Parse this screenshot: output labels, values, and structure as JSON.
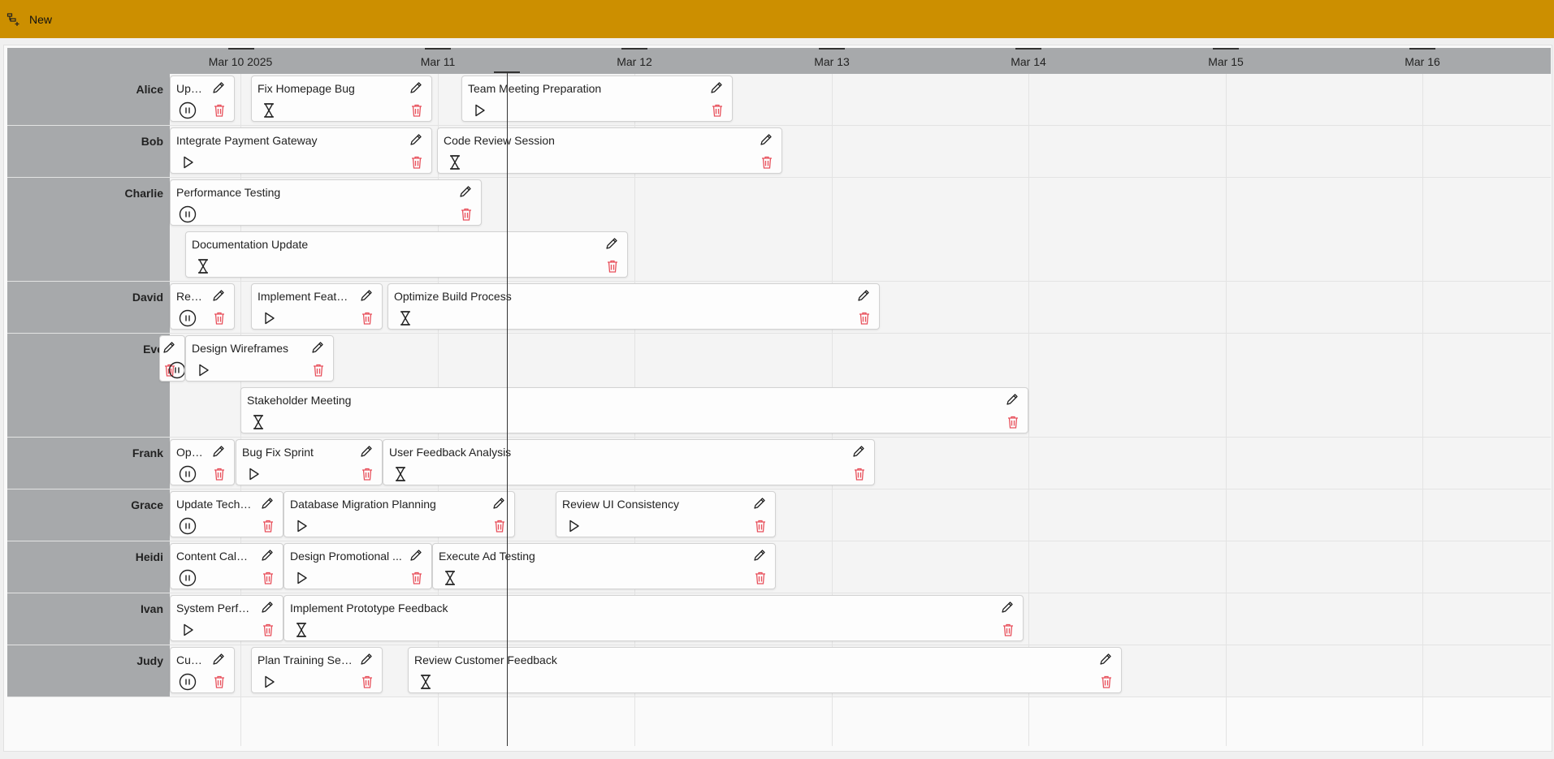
{
  "toolbar": {
    "new_label": "New"
  },
  "timeline": {
    "day_labels": [
      "Mar 10 2025",
      "Mar 11",
      "Mar 12",
      "Mar 13",
      "Mar 14",
      "Mar 15",
      "Mar 16"
    ]
  },
  "lanes": [
    "Alice",
    "Bob",
    "Charlie",
    "David",
    "Eve",
    "Frank",
    "Grace",
    "Heidi",
    "Ivan",
    "Judy"
  ],
  "tasks": [
    {
      "title": "Upd...",
      "status": "paused"
    },
    {
      "title": "Fix Homepage Bug",
      "status": "pending"
    },
    {
      "title": "Team Meeting Preparation",
      "status": "ready"
    },
    {
      "title": "Integrate Payment Gateway",
      "status": "ready"
    },
    {
      "title": "Code Review Session",
      "status": "pending"
    },
    {
      "title": "Performance Testing",
      "status": "paused"
    },
    {
      "title": "Documentation Update",
      "status": "pending"
    },
    {
      "title": "Revi...",
      "status": "paused"
    },
    {
      "title": "Implement Featur...",
      "status": "ready"
    },
    {
      "title": "Optimize Build Process",
      "status": "pending"
    },
    {
      "title": "",
      "status": "paused"
    },
    {
      "title": "Design Wireframes",
      "status": "ready"
    },
    {
      "title": "Stakeholder Meeting",
      "status": "pending"
    },
    {
      "title": "Opti...",
      "status": "paused"
    },
    {
      "title": "Bug Fix Sprint",
      "status": "ready"
    },
    {
      "title": "User Feedback Analysis",
      "status": "pending"
    },
    {
      "title": "Update Techni...",
      "status": "paused"
    },
    {
      "title": "Database Migration Planning",
      "status": "ready"
    },
    {
      "title": "Review UI Consistency",
      "status": "ready"
    },
    {
      "title": "Content Calen...",
      "status": "paused"
    },
    {
      "title": "Design Promotional ...",
      "status": "ready"
    },
    {
      "title": "Execute Ad Testing",
      "status": "pending"
    },
    {
      "title": "System Perfor...",
      "status": "ready"
    },
    {
      "title": "Implement Prototype Feedback",
      "status": "pending"
    },
    {
      "title": "Cust...",
      "status": "paused"
    },
    {
      "title": "Plan Training Sess...",
      "status": "ready"
    },
    {
      "title": "Review Customer Feedback",
      "status": "pending"
    }
  ],
  "icons": {
    "new": "gantt-new-icon",
    "edit": "pencil-icon",
    "delete": "trash-icon",
    "paused": "pause-circle-icon",
    "ready": "play-icon",
    "pending": "hourglass-icon"
  },
  "colors": {
    "toolbar": "#cc8f00",
    "delete": "#e8505b",
    "lane_header": "#a7a9ab"
  }
}
